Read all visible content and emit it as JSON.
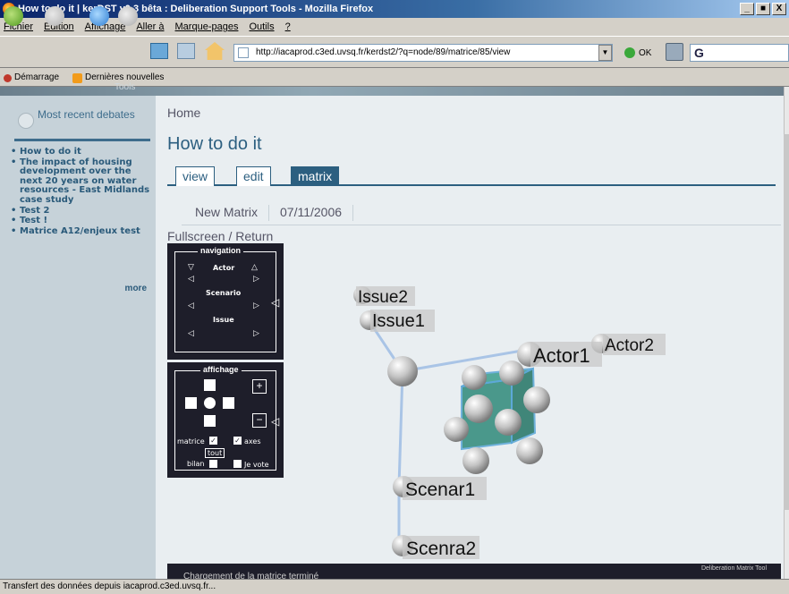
{
  "window": {
    "title": "How to do it | kerDST v0.3 bêta : Deliberation Support Tools - Mozilla Firefox",
    "buttons": [
      "_",
      "■",
      "X"
    ]
  },
  "menu": [
    "Fichier",
    "Edition",
    "Affichage",
    "Aller à",
    "Marque-pages",
    "Outils",
    "?"
  ],
  "address": {
    "url": "http://iacaprod.c3ed.uvsq.fr/kerdst2/?q=node/89/matrice/85/view",
    "go_label": "OK",
    "search_value": "G"
  },
  "bookmarks": [
    "Démarrage",
    "Dernières nouvelles"
  ],
  "sidebar": {
    "header_fragment": "Tools",
    "title": "Most recent debates",
    "items": [
      "How to do it",
      "The impact of housing development over the next 20 years on water resources - East Midlands case study",
      "Test 2",
      "Test !",
      "Matrice A12/enjeux test"
    ],
    "more": "more"
  },
  "page": {
    "breadcrumb": "Home",
    "title": "How to do it",
    "tabs": [
      {
        "label": "view",
        "active": false
      },
      {
        "label": "edit",
        "active": false
      },
      {
        "label": "matrix",
        "active": true
      }
    ],
    "matrix_name": "New Matrix",
    "matrix_date": "07/11/2006",
    "fullscreen_link": "Fullscreen / Return"
  },
  "navigation_panel": {
    "title": "navigation",
    "rows": [
      "Actor",
      "Scenario",
      "Issue"
    ]
  },
  "affichage_panel": {
    "title": "affichage",
    "checkboxes": [
      {
        "label": "matrice",
        "checked": true
      },
      {
        "label": "axes",
        "checked": true
      },
      {
        "label": "bilan",
        "checked": false
      },
      {
        "label": "Je vote",
        "checked": false
      }
    ],
    "tout_label": "tout"
  },
  "matrix_labels": {
    "issue2": "Issue2",
    "issue1": "Issue1",
    "actor1": "Actor1",
    "actor2": "Actor2",
    "scenar1": "Scenar1",
    "scenra2": "Scenra2"
  },
  "footer": {
    "status": "Chargement de la matrice terminé",
    "brand": "Deliberation Matrix Tool"
  },
  "statusbar": "Transfert des données depuis iacaprod.c3ed.uvsq.fr..."
}
